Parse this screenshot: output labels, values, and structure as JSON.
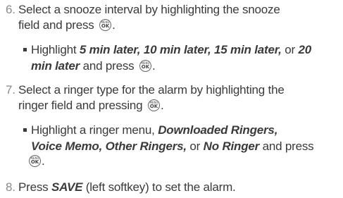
{
  "step6": {
    "number": "6.",
    "line1": "Select a snooze interval by highlighting the snooze",
    "line2_pre": "field and press",
    "line2_post": ".",
    "bullet": {
      "pre": "Highlight",
      "option1": "5 min later, 10 min later, 15 min later,",
      "or": " or ",
      "option2a": "20",
      "option2b": "min later",
      "post": " and press",
      "end": "."
    }
  },
  "step7": {
    "number": "7.",
    "line1": "Select a ringer type for the alarm by highlighting the",
    "line2_pre": "ringer field and pressing",
    "line2_post": ".",
    "bullet": {
      "pre": "Highlight a ringer menu,",
      "opt1": "Downloaded Ringers,",
      "opt2": "Voice Memo, Other Ringers,",
      "or": " or ",
      "opt3": "No Ringer",
      "post": " and press",
      "end": "."
    }
  },
  "step8": {
    "number": "8.",
    "pre": "Press",
    "key": "SAVE",
    "post": " (left softkey) to set the alarm."
  },
  "ok_icon": {
    "top": "MENU",
    "bottom": "OK"
  }
}
